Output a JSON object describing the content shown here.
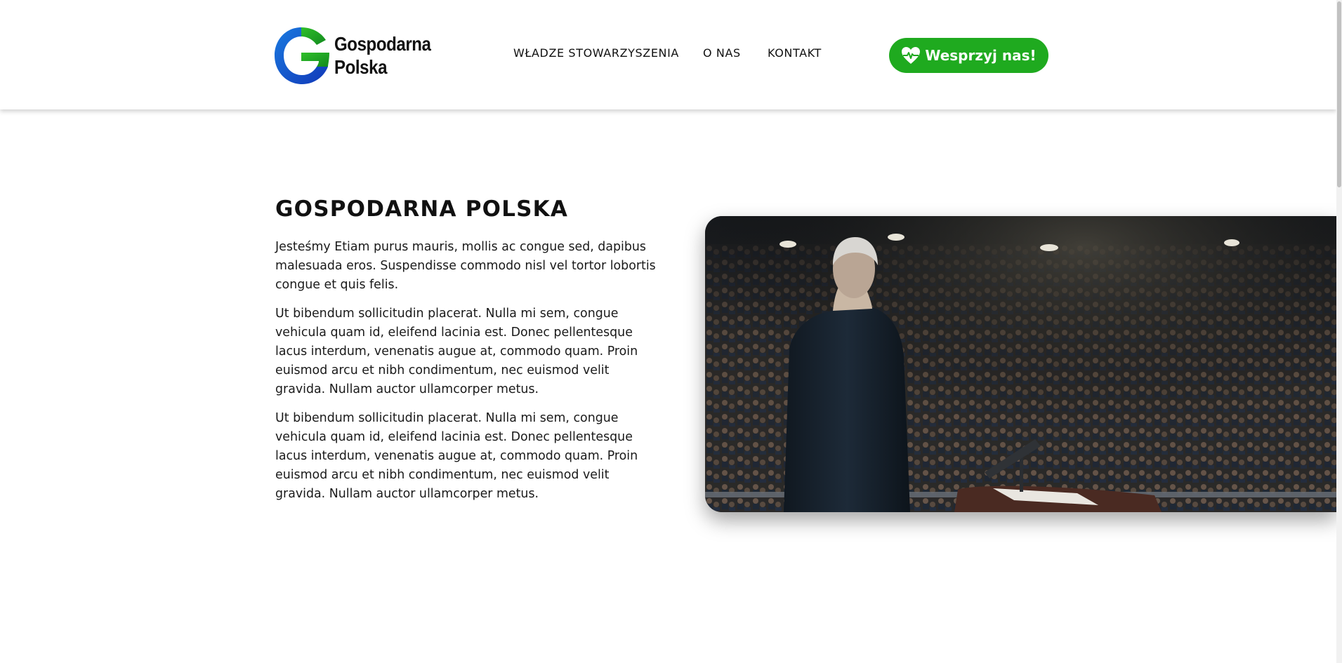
{
  "header": {
    "logo": {
      "line1": "Gospodarna",
      "line2": "Polska"
    },
    "nav": [
      {
        "label": "WŁADZE STOWARZYSZENIA"
      },
      {
        "label": "O NAS"
      },
      {
        "label": "KONTAKT"
      }
    ],
    "donate_label": "Wesprzyj nas!"
  },
  "main": {
    "title": "GOSPODARNA POLSKA",
    "paragraphs": [
      "Jesteśmy Etiam purus mauris, mollis ac congue sed, dapibus malesuada eros. Suspendisse commodo nisl vel tortor lobortis congue et quis felis.",
      "Ut bibendum sollicitudin placerat. Nulla mi sem, congue vehicula quam id, eleifend lacinia est. Donec pellentesque lacus interdum, venenatis augue at, commodo quam. Proin euismod arcu et nibh condimentum, nec euismod velit gravida. Nullam auctor ullamcorper metus.",
      "Ut bibendum sollicitudin placerat. Nulla mi sem, congue vehicula quam id, eleifend lacinia est. Donec pellentesque lacus interdum, venenatis augue at, commodo quam. Proin euismod arcu et nibh condimentum, nec euismod velit gravida. Nullam auctor ullamcorper metus."
    ]
  },
  "colors": {
    "accent_green": "#1faa1f",
    "logo_blue": "#1560d8",
    "logo_green": "#1faa1f"
  },
  "icons": {
    "donate": "heart-pulse-icon",
    "logo": "g-logo-icon"
  }
}
